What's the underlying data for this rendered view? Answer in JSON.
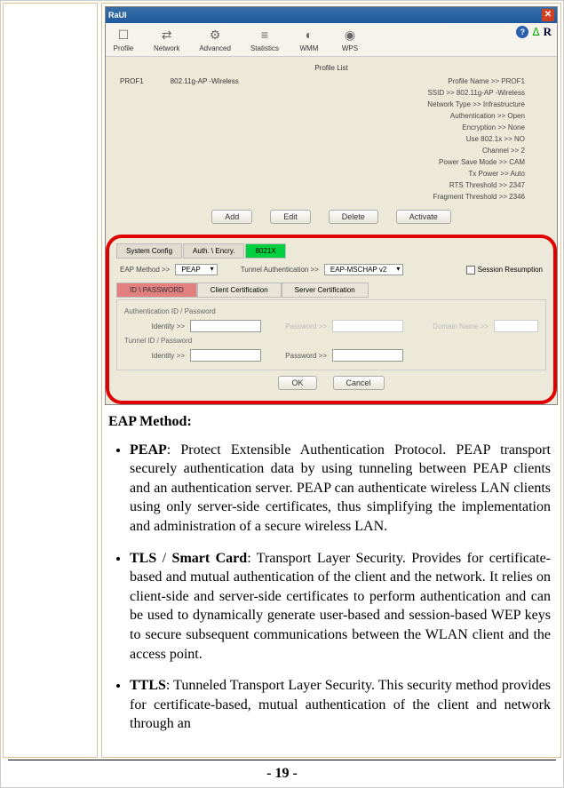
{
  "window": {
    "title": "RaUI",
    "close": "✕"
  },
  "toolbar": {
    "items": [
      {
        "icon": "☐",
        "label": "Profile"
      },
      {
        "icon": "⇄",
        "label": "Network"
      },
      {
        "icon": "⚙",
        "label": "Advanced"
      },
      {
        "icon": "≡",
        "label": "Statistics"
      },
      {
        "icon": "◐",
        "label": "WMM"
      },
      {
        "icon": "◉",
        "label": "WPS"
      }
    ],
    "help": "?",
    "brand": "R"
  },
  "profile": {
    "list_label": "Profile List",
    "name": "PROF1",
    "ssid_col": "802.11g-AP -Wireless",
    "details": [
      "Profile Name >> PROF1",
      "SSID >> 802.11g-AP -Wireless",
      "Network Type >> Infrastructure",
      "Authentication >> Open",
      "Encryption >> None",
      "Use 802.1x >> NO",
      "Channel >> 2",
      "Power Save Mode >> CAM",
      "Tx Power >> Auto",
      "RTS Threshold >> 2347",
      "Fragment Threshold >> 2346"
    ],
    "buttons": {
      "add": "Add",
      "edit": "Edit",
      "delete": "Delete",
      "activate": "Activate"
    }
  },
  "config": {
    "subtabs": {
      "system": "System Config",
      "auth": "Auth. \\ Encry.",
      "x8021": "8021X"
    },
    "eap_method_label": "EAP Method >>",
    "eap_method_value": "PEAP",
    "tunnel_label": "Tunnel Authentication >>",
    "tunnel_value": "EAP-MSCHAP v2",
    "session_label": "Session Resumption",
    "authtabs": {
      "idpw": "ID \\ PASSWORD",
      "client": "Client Certification",
      "server": "Server Certification"
    },
    "group1": "Authentication ID / Password",
    "group2": "Tunnel ID / Password",
    "identity_label": "Identity >>",
    "password_label": "Password >>",
    "domain_label": "Domain Name >>",
    "ok": "OK",
    "cancel": "Cancel"
  },
  "text": {
    "heading": "EAP Method",
    "peap_term": "PEAP",
    "peap_body": ": Protect Extensible Authentication Protocol. PEAP transport securely authentication data by using tunneling between PEAP clients and an authentication server. PEAP can authenticate wireless LAN clients using only server-side certificates, thus simplifying the implementation and administration of a secure wireless LAN.",
    "tls_term": "TLS",
    "tls_sep": " / ",
    "smart_term": "Smart Card",
    "tls_body": ": Transport Layer Security. Provides for certificate-based and mutual authentication of the client and the network. It relies on client-side and server-side certificates to perform authentication and can be used to dynamically generate user-based and session-based WEP keys to secure subsequent communications between the WLAN client and the access point.",
    "ttls_term": "TTLS",
    "ttls_body": ": Tunneled Transport Layer Security. This security method provides for certificate-based, mutual authentication of the client and network through an"
  },
  "footer": "- 19 -"
}
